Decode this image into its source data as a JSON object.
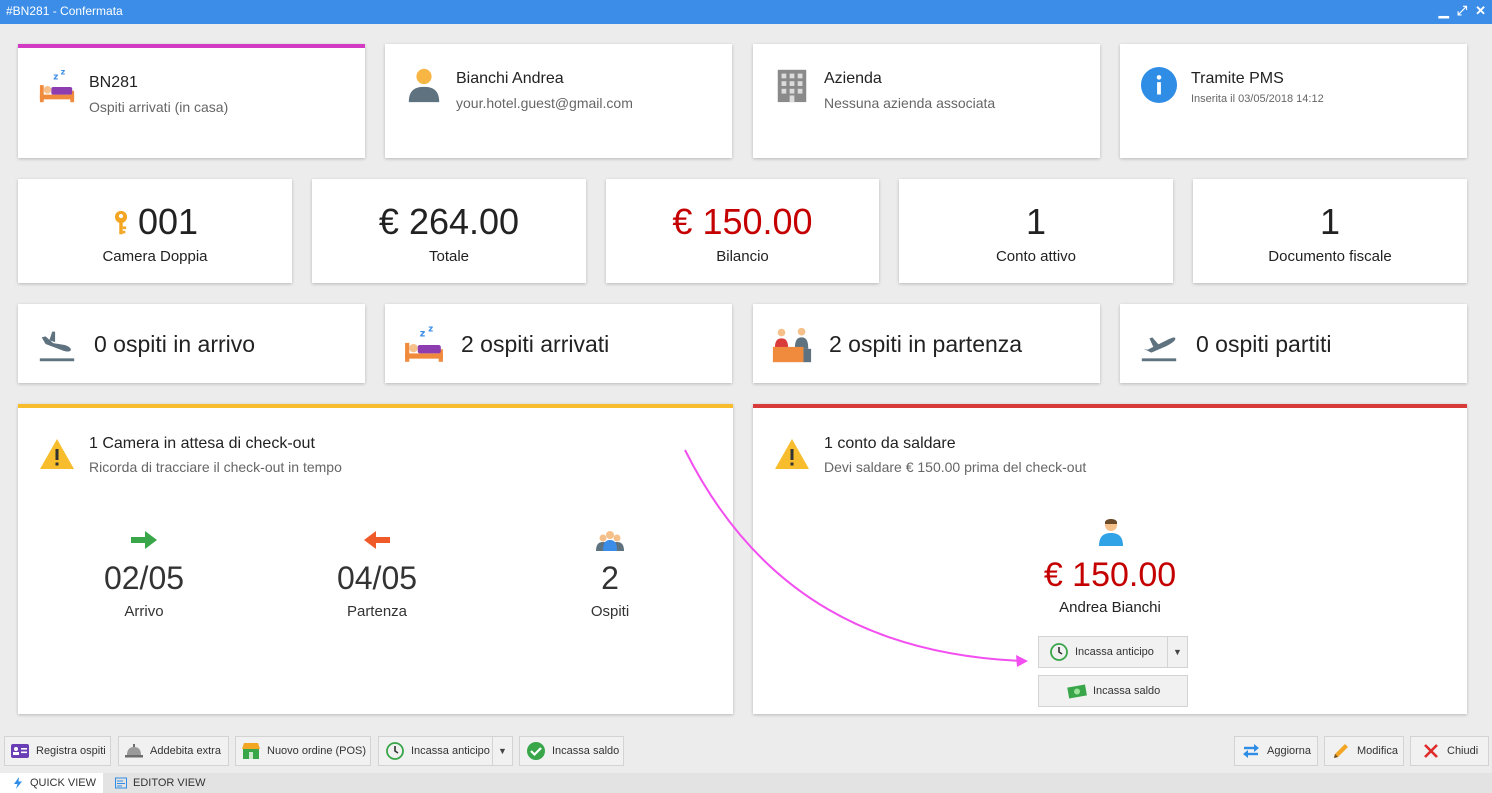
{
  "window": {
    "title": "#BN281 - Confermata"
  },
  "info_cards": {
    "booking": {
      "title": "BN281",
      "subtitle": "Ospiti arrivati (in casa)",
      "accent": "#d33bc4"
    },
    "guest": {
      "title": "Bianchi Andrea",
      "subtitle": "your.hotel.guest@gmail.com"
    },
    "company": {
      "title": "Azienda",
      "subtitle": "Nessuna azienda associata"
    },
    "source": {
      "title": "Tramite PMS",
      "subtitle": "Inserita il 03/05/2018 14:12"
    }
  },
  "stats": {
    "room": {
      "value": "001",
      "label": "Camera Doppia"
    },
    "total": {
      "value": "€ 264.00",
      "label": "Totale"
    },
    "balance": {
      "value": "€ 150.00",
      "label": "Bilancio",
      "color": "#c40000"
    },
    "accounts": {
      "value": "1",
      "label": "Conto attivo"
    },
    "documents": {
      "value": "1",
      "label": "Documento fiscale"
    }
  },
  "flow": {
    "arriving": "0 ospiti in arrivo",
    "arrived": "2 ospiti arrivati",
    "departing": "2 ospiti in partenza",
    "departed": "0 ospiti partiti"
  },
  "checkout_alert": {
    "title": "1 Camera in attesa di check-out",
    "subtitle": "Ricorda di tracciare il check-out in tempo",
    "accent": "#f7bd2d",
    "arrival": {
      "value": "02/05",
      "label": "Arrivo"
    },
    "departure": {
      "value": "04/05",
      "label": "Partenza"
    },
    "guests": {
      "value": "2",
      "label": "Ospiti"
    }
  },
  "payment_alert": {
    "title": "1 conto da saldare",
    "subtitle": "Devi saldare € 150.00 prima del check-out",
    "accent": "#d93b3b",
    "amount": "€ 150.00",
    "name": "Andrea Bianchi",
    "advance_button": "Incassa anticipo",
    "settle_button": "Incassa saldo"
  },
  "toolbar": {
    "register_guests": "Registra ospiti",
    "charge_extra": "Addebita extra",
    "new_order": "Nuovo ordine (POS)",
    "advance": "Incassa anticipo",
    "settle": "Incassa saldo",
    "refresh": "Aggiorna",
    "edit": "Modifica",
    "close": "Chiudi"
  },
  "tabs": {
    "quick": "QUICK VIEW",
    "editor": "EDITOR VIEW"
  },
  "colors": {
    "titlebar": "#3b8de8",
    "negative": "#c40000",
    "annotation_arrow": "#f24ff0"
  }
}
